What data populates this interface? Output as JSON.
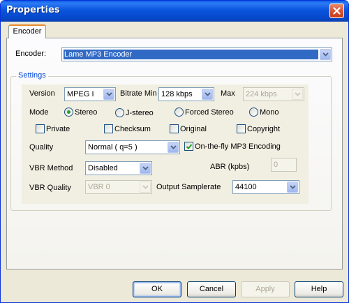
{
  "window": {
    "title": "Properties"
  },
  "tabs": [
    {
      "label": "Encoder"
    }
  ],
  "encoder": {
    "label": "Encoder:",
    "value": "Lame MP3 Encoder"
  },
  "settings": {
    "legend": "Settings",
    "version": {
      "label": "Version",
      "value": "MPEG I"
    },
    "bitrate_min": {
      "label": "Bitrate Min",
      "value": "128 kbps"
    },
    "max": {
      "label": "Max",
      "value": "224 kbps"
    },
    "mode": {
      "label": "Mode",
      "options": [
        "Stereo",
        "J-stereo",
        "Forced Stereo",
        "Mono"
      ],
      "selected": "Stereo"
    },
    "flags": [
      {
        "label": "Private",
        "checked": false
      },
      {
        "label": "Checksum",
        "checked": false
      },
      {
        "label": "Original",
        "checked": false
      },
      {
        "label": "Copyright",
        "checked": false
      }
    ],
    "quality": {
      "label": "Quality",
      "value": "Normal ( q=5 )"
    },
    "on_the_fly": {
      "label": "On-the-fly MP3 Encoding",
      "checked": true
    },
    "vbr_method": {
      "label": "VBR Method",
      "value": "Disabled"
    },
    "abr": {
      "label": "ABR (kpbs)",
      "value": "0"
    },
    "vbr_quality": {
      "label": "VBR Quality",
      "value": "VBR 0"
    },
    "output_samplerate": {
      "label": "Output Samplerate",
      "value": "44100"
    }
  },
  "buttons": {
    "ok": "OK",
    "cancel": "Cancel",
    "apply": "Apply",
    "help": "Help"
  },
  "colors": {
    "titlebar": "#0a5ee9",
    "selection": "#316ac5",
    "group_legend": "#0046d5"
  }
}
